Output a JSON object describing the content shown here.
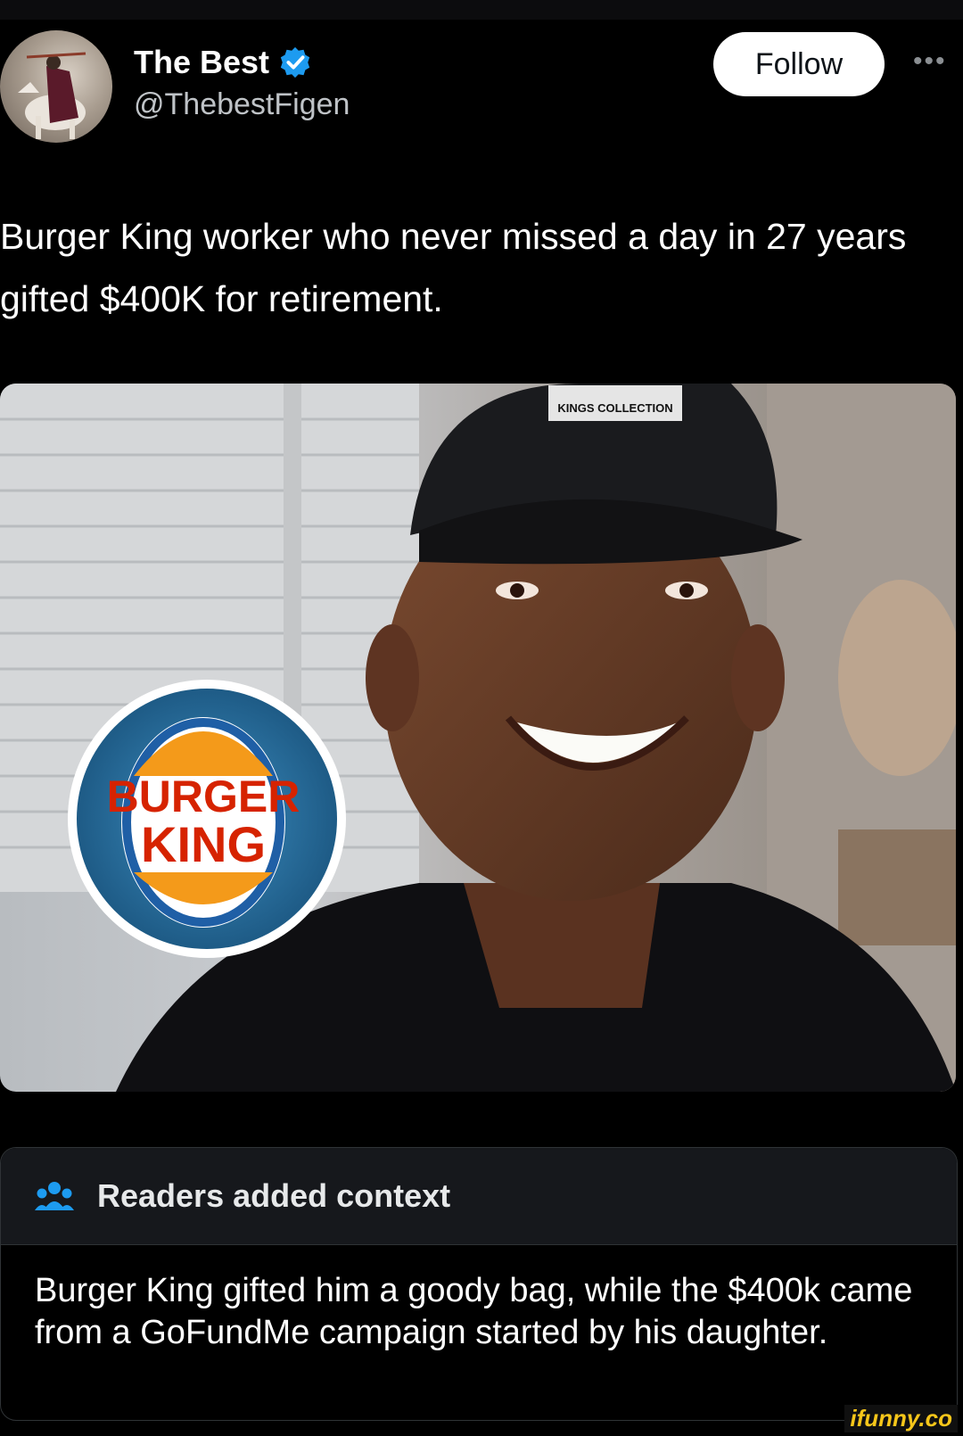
{
  "post": {
    "author_name": "The Best",
    "author_handle": "@ThebestFigen",
    "follow_label": "Follow",
    "more_label": "•••",
    "text": "Burger King worker who never missed a day in 27 years gifted $400K for retirement."
  },
  "image": {
    "badge_line1": "BURGER",
    "badge_line2": "KING",
    "cap_text": "KINGS COLLECTION"
  },
  "community_note": {
    "title": "Readers added context",
    "body": "Burger King gifted him a goody bag, while the $400k came from a GoFundMe campaign started by his daughter."
  },
  "watermark": "ifunny.co",
  "colors": {
    "background": "#000000",
    "verified": "#1d9bf0",
    "note_icon": "#1d9bf0",
    "watermark": "#f6c61a"
  }
}
